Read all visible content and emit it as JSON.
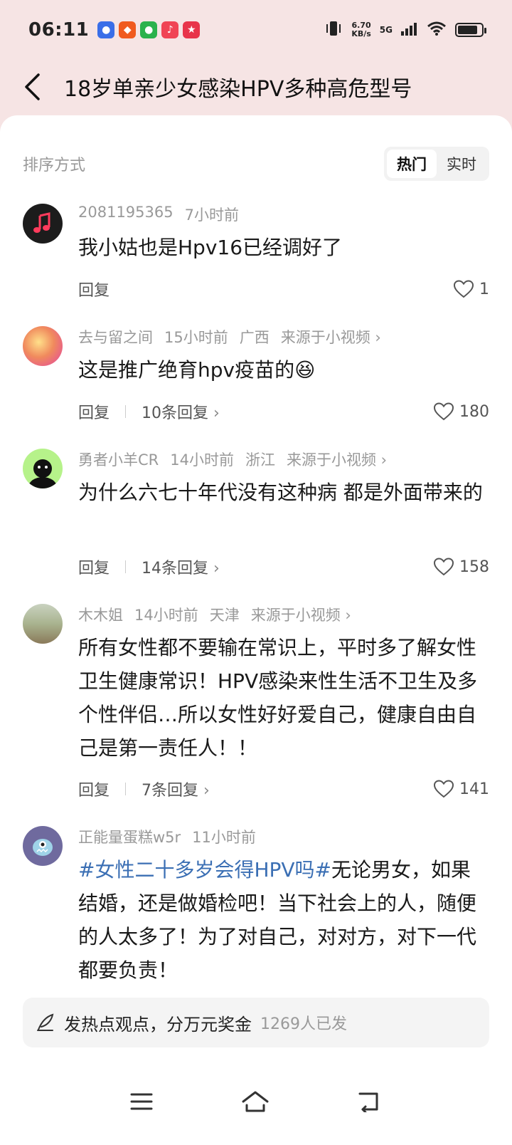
{
  "status": {
    "time": "06:11",
    "net_speed_value": "6.70",
    "net_speed_unit": "KB/s",
    "network": "5G",
    "battery_level": 0.85
  },
  "header": {
    "title": "18岁单亲少女感染HPV多种高危型号"
  },
  "sort": {
    "label": "排序方式",
    "tabs": [
      "热门",
      "实时"
    ],
    "active": "热门"
  },
  "comments": [
    {
      "user": "2081195365",
      "time": "7小时前",
      "location": "",
      "source": "",
      "text": "我小姑也是Hpv16已经调好了",
      "reply_label": "回复",
      "replies": "",
      "likes": "1"
    },
    {
      "user": "去与留之间",
      "time": "15小时前",
      "location": "广西",
      "source": "来源于小视频",
      "text": "这是推广绝育hpv疫苗的😆",
      "reply_label": "回复",
      "replies": "10条回复",
      "likes": "180"
    },
    {
      "user": "勇者小羊CR",
      "time": "14小时前",
      "location": "浙江",
      "source": "来源于小视频",
      "text": "为什么六七十年代没有这种病 都是外面带来的",
      "reply_label": "回复",
      "replies": "14条回复",
      "likes": "158"
    },
    {
      "user": "木木姐",
      "time": "14小时前",
      "location": "天津",
      "source": "来源于小视频",
      "text": "所有女性都不要输在常识上，平时多了解女性卫生健康常识！HPV感染来性生活不卫生及多个性伴侣…所以女性好好爱自己，健康自由自己是第一责任人！！",
      "reply_label": "回复",
      "replies": "7条回复",
      "likes": "141"
    },
    {
      "user": "正能量蛋糕w5r",
      "time": "11小时前",
      "location": "",
      "source": "",
      "tag": "#女性二十多岁会得HPV吗#",
      "text": "无论男女，如果结婚，还是做婚检吧！当下社会上的人，随便的人太多了！为了对自己，对对方，对下一代都要负责！"
    }
  ],
  "post_bar": {
    "text": "发热点观点，分万元奖金",
    "count": "1269人已发"
  }
}
